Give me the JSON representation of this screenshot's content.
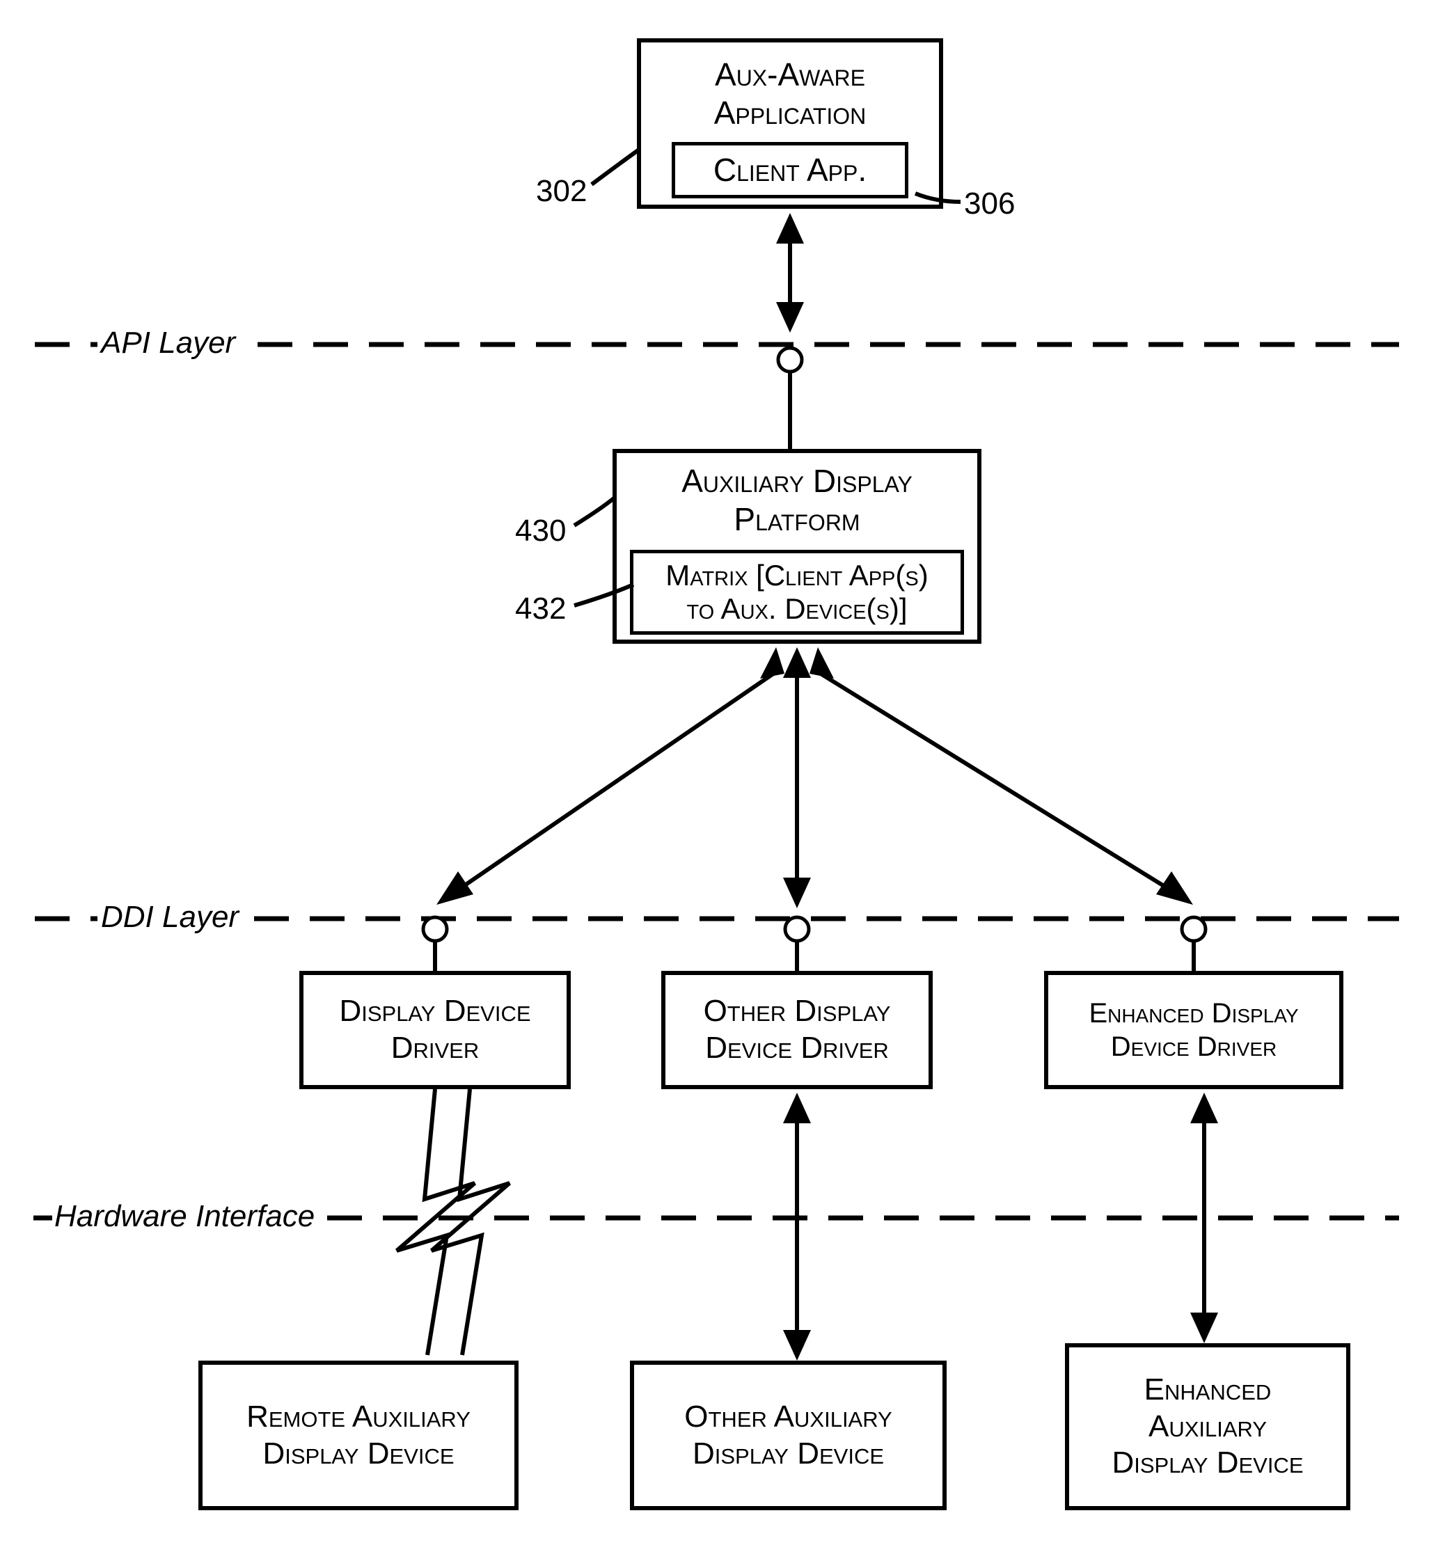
{
  "boxes": {
    "auxAware": {
      "line1": "Aux-Aware",
      "line2": "Application"
    },
    "clientApp": "Client App.",
    "auxPlatform": {
      "line1": "Auxiliary Display",
      "line2": "Platform"
    },
    "matrix": {
      "line1": "Matrix [Client App(s)",
      "line2": "to Aux. Device(s)]"
    },
    "displayDriver": {
      "line1": "Display Device",
      "line2": "Driver"
    },
    "otherDriver": {
      "line1": "Other Display",
      "line2": "Device Driver"
    },
    "enhancedDriver": {
      "line1": "Enhanced Display",
      "line2": "Device Driver"
    },
    "remoteDevice": {
      "line1": "Remote Auxiliary",
      "line2": "Display Device"
    },
    "otherDevice": {
      "line1": "Other Auxiliary",
      "line2": "Display Device"
    },
    "enhancedDevice": {
      "line1": "Enhanced",
      "line2": "Auxiliary",
      "line3": "Display Device"
    }
  },
  "layers": {
    "api": "API Layer",
    "ddi": "DDI Layer",
    "hardware": "Hardware Interface"
  },
  "refs": {
    "r302": "302",
    "r306": "306",
    "r430": "430",
    "r432": "432"
  }
}
